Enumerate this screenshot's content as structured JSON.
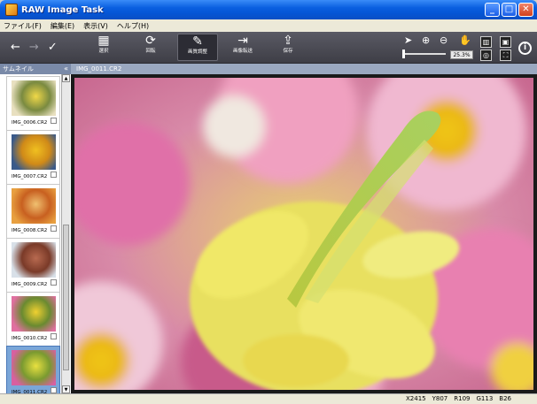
{
  "window": {
    "title": "RAW Image Task"
  },
  "menu": [
    "ファイル(F)",
    "編集(E)",
    "表示(V)",
    "ヘルプ(H)"
  ],
  "toolbar": {
    "tools": [
      {
        "label": "選択",
        "icon": "grid-icon",
        "glyph": "▦"
      },
      {
        "label": "回転",
        "icon": "rotate-icon",
        "glyph": "⟳"
      },
      {
        "label": "画質調整",
        "icon": "adjust-icon",
        "glyph": "✎",
        "active": true
      },
      {
        "label": "画像転送",
        "icon": "transfer-icon",
        "glyph": "⇥"
      },
      {
        "label": "保存",
        "icon": "save-icon",
        "glyph": "⇪"
      }
    ],
    "zoom": "25.3%"
  },
  "thumbnails": {
    "header": "サムネイル",
    "items": [
      {
        "name": "IMG_0006.CR2",
        "colors": [
          "#e8e0c0",
          "#f0d848",
          "#7a8a40"
        ]
      },
      {
        "name": "IMG_0007.CR2",
        "colors": [
          "#3a5a8a",
          "#f0c020",
          "#d08a18"
        ]
      },
      {
        "name": "IMG_0008.CR2",
        "colors": [
          "#e8a040",
          "#f0c070",
          "#c86020"
        ]
      },
      {
        "name": "IMG_0009.CR2",
        "colors": [
          "#d8e0e8",
          "#b86a50",
          "#7a3a28"
        ]
      },
      {
        "name": "IMG_0010.CR2",
        "colors": [
          "#e070a0",
          "#f0d030",
          "#6a8a30"
        ]
      },
      {
        "name": "IMG_0011.CR2",
        "colors": [
          "#d860a0",
          "#e8e040",
          "#7a9a30"
        ],
        "selected": true
      }
    ]
  },
  "image": {
    "filename": "IMG_0011.CR2"
  },
  "status": {
    "x": "X2415",
    "y": "Y807",
    "r": "R109",
    "g": "G113",
    "b": "B26"
  }
}
